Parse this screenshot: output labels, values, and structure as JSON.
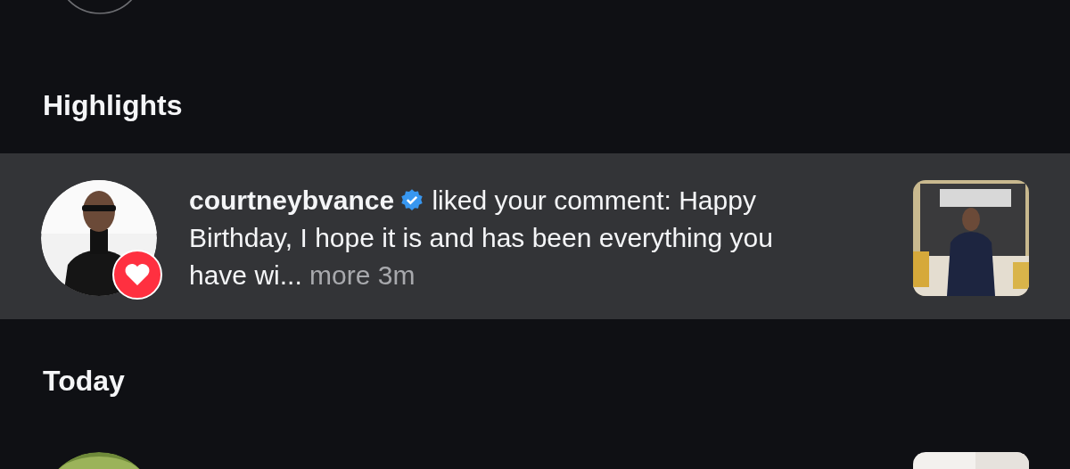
{
  "sections": [
    {
      "title": "Highlights",
      "items": [
        {
          "username": "courtneybvance",
          "verified": true,
          "heart_badge": true,
          "selected": true,
          "message": " liked your comment: Happy Birthday, I hope it is and has been everything you have wi...",
          "more": "more",
          "time": "3m"
        }
      ]
    },
    {
      "title": "Today",
      "items": [
        {
          "selected": false
        }
      ]
    }
  ]
}
